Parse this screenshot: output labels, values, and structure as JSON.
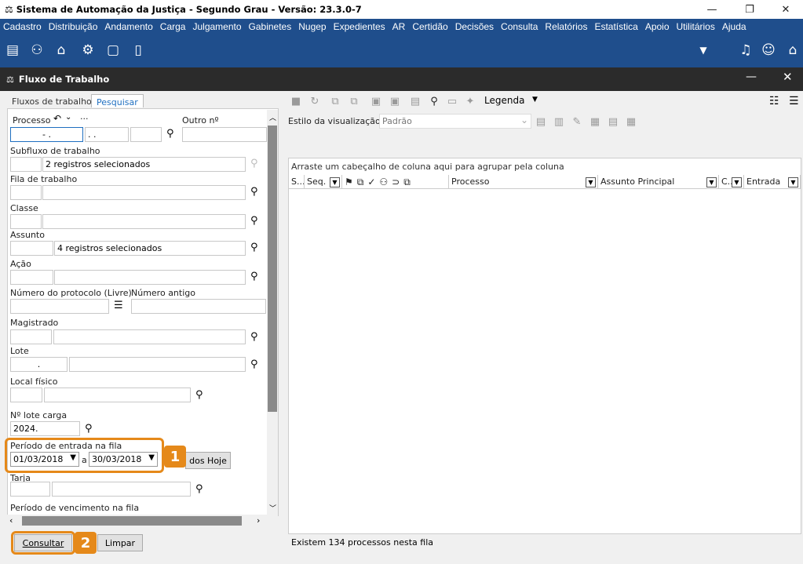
{
  "window": {
    "title": "Sistema de Automação da Justiça - Segundo Grau - Versão: 23.3.0-7"
  },
  "menu": [
    "Cadastro",
    "Distribuição",
    "Andamento",
    "Carga",
    "Julgamento",
    "Gabinetes",
    "Nugep",
    "Expedientes",
    "AR",
    "Certidão",
    "Decisões",
    "Consulta",
    "Relatórios",
    "Estatística",
    "Apoio",
    "Utilitários",
    "Ajuda"
  ],
  "subwindow": {
    "title": "Fluxo de Trabalho"
  },
  "tabs": [
    {
      "label": "Fluxos de trabalho",
      "active": false
    },
    {
      "label": "Pesquisar",
      "active": true
    }
  ],
  "form": {
    "processo_label": "Processo",
    "processo_value": "-  .",
    "processo_part2": ".  .",
    "dots": "···",
    "outro_label": "Outro nº",
    "subfluxo_label": "Subfluxo de trabalho",
    "subfluxo_value": "2 registros selecionados",
    "fila_label": "Fila de trabalho",
    "classe_label": "Classe",
    "assunto_label": "Assunto",
    "assunto_value": "4 registros selecionados",
    "acao_label": "Ação",
    "protocolo_label": "Número do protocolo (Livre)",
    "antigo_label": "Número antigo",
    "magistrado_label": "Magistrado",
    "lote_label": "Lote",
    "lote_value": ".",
    "local_label": "Local físico",
    "lotecarga_label": "Nº lote carga",
    "lotecarga_value": "2024.",
    "periodo_label": "Período de entrada na fila",
    "data_ini": "01/03/2018",
    "a_label": "a",
    "data_fim": "30/03/2018",
    "todos_hoje": "dos Hoje",
    "tarja_label": "Tarja",
    "vencimento_label": "Período de vencimento na fila"
  },
  "buttons": {
    "consultar": "Consultar",
    "limpar": "Limpar"
  },
  "callouts": [
    "1",
    "2"
  ],
  "right": {
    "legenda": "Legenda",
    "estilo_label": "Estilo da visualização",
    "estilo_value": "Padrão",
    "group_hint": "Arraste um cabeçalho de coluna aqui para agrupar pela coluna",
    "columns": [
      "S...",
      "Seq.",
      "Processo",
      "Assunto Principal",
      "C...",
      "Entrada"
    ],
    "status": "Existem 134 processos nesta fila"
  },
  "colors": {
    "menubar": "#1f4e8c",
    "accent": "#e5891a",
    "tab_active": "#1f6fc0"
  }
}
